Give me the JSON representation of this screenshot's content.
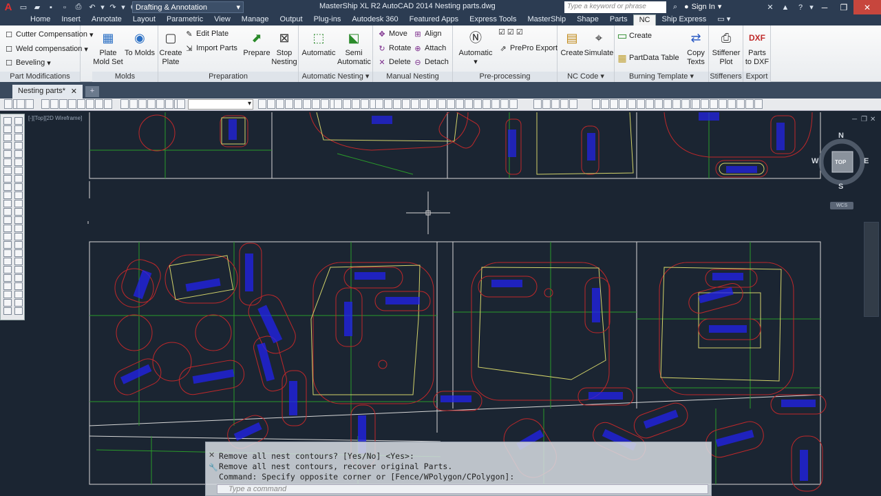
{
  "app": {
    "title": "MasterShip XL R2 AutoCAD 2014   Nesting parts.dwg",
    "logo": "A",
    "workspace": "Drafting & Annotation",
    "search_placeholder": "Type a keyword or phrase",
    "sign_in": "Sign In"
  },
  "ribbon_tabs": [
    "Home",
    "Insert",
    "Annotate",
    "Layout",
    "Parametric",
    "View",
    "Manage",
    "Output",
    "Plug-ins",
    "Autodesk 360",
    "Featured Apps",
    "Express Tools",
    "MasterShip",
    "Shape",
    "Parts",
    "NC",
    "Ship Express"
  ],
  "active_tab": "NC",
  "panels": {
    "part_mods": {
      "title": "Part Modifications",
      "cutter": "Cutter Compensation",
      "weld": "Weld compensation",
      "bevel": "Beveling"
    },
    "molds": {
      "title": "Molds",
      "plate_mold": "Plate\nMold Set",
      "to_molds": "To Molds"
    },
    "preparation": {
      "title": "Preparation",
      "create_plate": "Create\nPlate",
      "edit_plate": "Edit Plate",
      "import_parts": "Import Parts",
      "prepare": "Prepare",
      "stop_nesting": "Stop\nNesting"
    },
    "auto_nesting": {
      "title": "Automatic Nesting",
      "automatic": "Automatic",
      "semi": "Semi\nAutomatic"
    },
    "manual_nesting": {
      "title": "Manual Nesting",
      "move": "Move",
      "rotate": "Rotate",
      "delete": "Delete",
      "align": "Align",
      "attach": "Attach",
      "detach": "Detach"
    },
    "preprocessing": {
      "title": "Pre-processing",
      "automatic": "Automatic",
      "prepro_export": "PrePro Export"
    },
    "nc_code": {
      "title": "NC Code",
      "create": "Create",
      "simulate": "Simulate"
    },
    "burning": {
      "title": "Burning Template",
      "create": "Create",
      "partdata": "PartData Table",
      "copy_texts": "Copy\nTexts"
    },
    "stiffeners": {
      "title": "Stiffeners",
      "plot": "Stiffener\nPlot"
    },
    "export": {
      "title": "Export",
      "parts_dxf": "Parts\nto DXF"
    }
  },
  "document_tab": "Nesting parts*",
  "viewport_label": "[-][Top][2D Wireframe]",
  "viewcube": {
    "n": "N",
    "s": "S",
    "e": "E",
    "w": "W",
    "face": "TOP",
    "wcs": "WCS"
  },
  "command": {
    "lines": [
      "Remove all nest contours? [Yes/No] <Yes>:",
      "Remove all nest contours, recover original Parts.",
      "Command: Specify opposite corner or [Fence/WPolygon/CPolygon]:"
    ],
    "placeholder": "Type a command"
  },
  "colors": {
    "canvas_bg": "#1b2532",
    "plate_outline": "#d8d8d8",
    "part_yellow": "#d4d46a",
    "contour_red": "#c0282a",
    "label_blue": "#2222ee",
    "green": "#2a9a2a"
  }
}
